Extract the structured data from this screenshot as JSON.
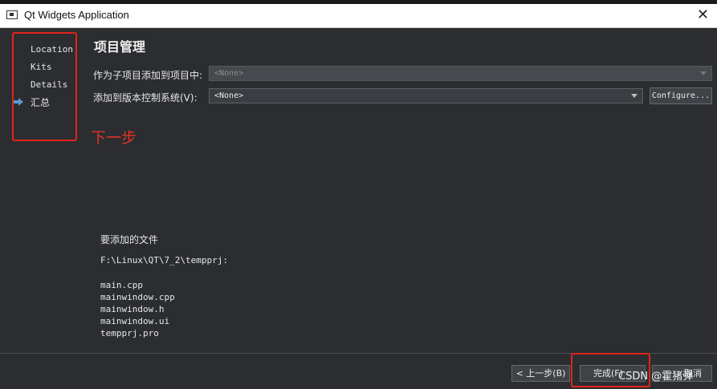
{
  "window": {
    "title": "Qt Widgets Application",
    "close_glyph": "✕"
  },
  "sidebar": {
    "items": [
      {
        "label": "Location"
      },
      {
        "label": "Kits"
      },
      {
        "label": "Details"
      },
      {
        "label": "汇总",
        "current": true
      }
    ]
  },
  "page": {
    "title": "项目管理",
    "add_as_subproject_label": "作为子项目添加到项目中:",
    "add_as_subproject_value": "<None>",
    "vcs_label": "添加到版本控制系统(V):",
    "vcs_value": "<None>",
    "configure_button": "Configure..."
  },
  "annotation": {
    "next_step": "下一步"
  },
  "files": {
    "title": "要添加的文件",
    "path": "F:\\Linux\\QT\\7_2\\tempprj:",
    "list": [
      "main.cpp",
      "mainwindow.cpp",
      "mainwindow.h",
      "mainwindow.ui",
      "tempprj.pro"
    ]
  },
  "buttons": {
    "back": "< 上一步(B)",
    "finish": "完成(F)",
    "cancel": "取消"
  },
  "watermark": "CSDN @霍猪弹",
  "colors": {
    "accent_red": "#e0241b",
    "background": "#2b2d30",
    "arrow": "#5b9bd5"
  }
}
